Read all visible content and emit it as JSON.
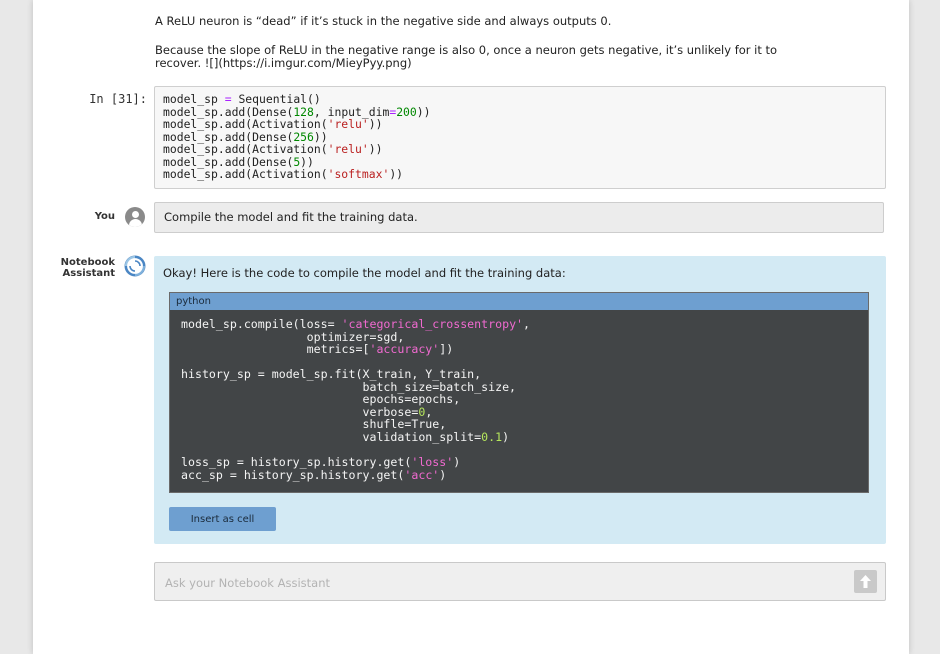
{
  "markdown": {
    "line1": "A ReLU neuron is “dead” if it’s stuck in the negative side and always outputs 0.",
    "line2": "Because the slope of ReLU in the negative range is also 0, once a neuron gets negative, it’s unlikely for it to",
    "line3": "recover. ![](https://i.imgur.com/MieyPyy.png)"
  },
  "code_cell": {
    "prompt": "In [31]:",
    "lines": [
      "model_sp = Sequential()",
      "model_sp.add(Dense(128, input_dim=200))",
      "model_sp.add(Activation('relu'))",
      "model_sp.add(Dense(256))",
      "model_sp.add(Activation('relu'))",
      "model_sp.add(Dense(5))",
      "model_sp.add(Activation('softmax'))"
    ]
  },
  "chat": {
    "user_label": "You",
    "user_message": "Compile the model and fit the training data.",
    "assistant_label_line1": "Notebook",
    "assistant_label_line2": "Assistant",
    "assistant_intro": "Okay! Here is the code to compile the model and fit the training data:",
    "code_language": "python",
    "code_lines": [
      "model_sp.compile(loss= 'categorical_crossentropy',",
      "                  optimizer=sgd,",
      "                  metrics=['accuracy'])",
      "",
      "history_sp = model_sp.fit(X_train, Y_train,",
      "                          batch_size=batch_size,",
      "                          epochs=epochs,",
      "                          verbose=0,",
      "                          shufle=True,",
      "                          validation_split=0.1)",
      "",
      "loss_sp = history_sp.history.get('loss')",
      "acc_sp = history_sp.history.get('acc')"
    ],
    "insert_button_label": "Insert as cell"
  },
  "input": {
    "placeholder": "Ask your Notebook Assistant",
    "value": ""
  },
  "icons": {
    "user_avatar": "user-avatar-icon",
    "assistant": "assistant-swirl-icon",
    "send": "arrow-up-icon"
  },
  "colors": {
    "assistant_bg": "#d3eaf4",
    "code_bg": "#424547",
    "accent": "#6e9fd0"
  }
}
